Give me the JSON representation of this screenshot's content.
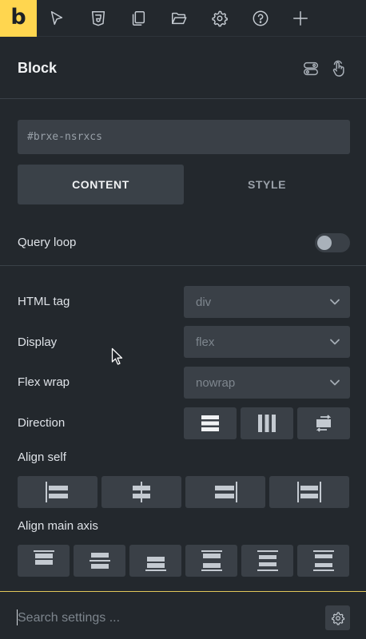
{
  "toolbar": {
    "logo_text": "b",
    "accent_color": "#ffd64f",
    "icons": [
      "cursor-arrow-icon",
      "css3-icon",
      "pages-icon",
      "folder-icon",
      "gear-icon",
      "help-icon",
      "plus-icon"
    ]
  },
  "header": {
    "title": "Block",
    "icons": [
      "toggle-settings-icon",
      "hand-pointer-icon"
    ]
  },
  "element_id": "#brxe-nsrxcs",
  "tabs": [
    {
      "label": "CONTENT",
      "active": true
    },
    {
      "label": "STYLE",
      "active": false
    }
  ],
  "query_loop": {
    "label": "Query loop",
    "enabled": false
  },
  "fields": {
    "html_tag": {
      "label": "HTML tag",
      "value": "div"
    },
    "display": {
      "label": "Display",
      "value": "flex"
    },
    "flex_wrap": {
      "label": "Flex wrap",
      "value": "nowrap"
    },
    "direction": {
      "label": "Direction",
      "options": [
        "column-icon",
        "row-icon",
        "reverse-icon"
      ]
    },
    "align_self": {
      "label": "Align self",
      "options": [
        "align-start-icon",
        "align-center-icon",
        "align-end-icon",
        "align-stretch-icon"
      ]
    },
    "align_main_axis": {
      "label": "Align main axis",
      "options": [
        "justify-start-icon",
        "justify-center-icon",
        "justify-end-icon",
        "space-between-icon",
        "space-around-icon",
        "space-evenly-icon"
      ]
    }
  },
  "search": {
    "placeholder": "Search settings ..."
  }
}
